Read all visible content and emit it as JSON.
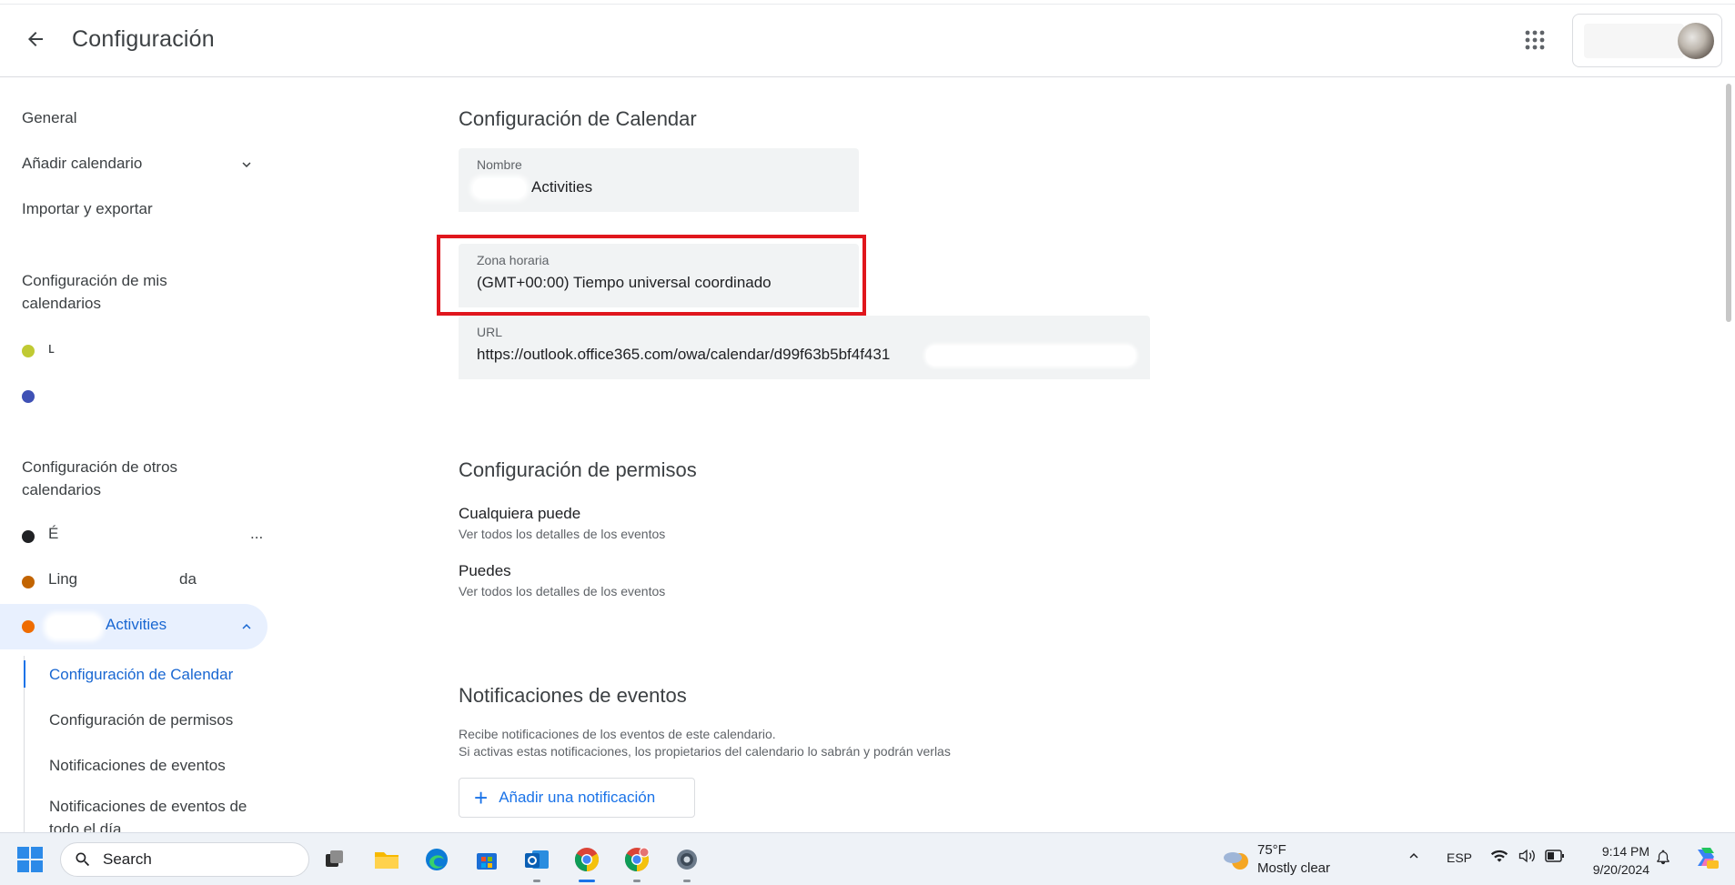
{
  "header": {
    "title": "Configuración"
  },
  "sidebar": {
    "general": "General",
    "add_calendar": "Añadir calendario",
    "import_export": "Importar y exportar",
    "my_calendars_title": "Configuración de mis calendarios",
    "my_calendars": [
      {
        "label": "ʟ",
        "color": "#c0ca33"
      },
      {
        "label": "",
        "color": "#3f51b5"
      }
    ],
    "other_calendars_title": "Configuración de otros calendarios",
    "other_calendars": [
      {
        "label": "É",
        "suffix": "...",
        "color": "#202124"
      },
      {
        "label": "Ling",
        "suffix": "da",
        "color": "#c26401"
      },
      {
        "label": "Activities",
        "color": "#ef6c00",
        "selected": true
      }
    ],
    "sub_items": [
      {
        "label": "Configuración de Calendar",
        "active": true
      },
      {
        "label": "Configuración de permisos"
      },
      {
        "label": "Notificaciones de eventos"
      },
      {
        "label": "Notificaciones de eventos de todo el día"
      }
    ]
  },
  "calendar_settings": {
    "title": "Configuración de Calendar",
    "name_label": "Nombre",
    "name_value": "Activities",
    "timezone_label": "Zona horaria",
    "timezone_value": "(GMT+00:00) Tiempo universal coordinado",
    "url_label": "URL",
    "url_value": "https://outlook.office365.com/owa/calendar/d99f63b5bf4f431",
    "highlight_color": "#e0161d"
  },
  "permissions": {
    "title": "Configuración de permisos",
    "items": [
      {
        "title": "Cualquiera puede",
        "desc": "Ver todos los detalles de los eventos"
      },
      {
        "title": "Puedes",
        "desc": "Ver todos los detalles de los eventos"
      }
    ]
  },
  "notifications": {
    "title": "Notificaciones de eventos",
    "desc_line1": "Recibe notificaciones de los eventos de este calendario.",
    "desc_line2": "Si activas estas notificaciones, los propietarios del calendario lo sabrán y podrán verlas",
    "add_button": "Añadir una notificación"
  },
  "taskbar": {
    "search_label": "Search",
    "weather_temp": "75°F",
    "weather_cond": "Mostly clear",
    "language": "ESP",
    "time": "9:14 PM",
    "date": "9/20/2024",
    "apps": [
      "task-view-icon",
      "file-explorer-icon",
      "edge-icon",
      "store-icon",
      "outlook-icon",
      "chrome-icon",
      "chrome-profile-icon",
      "settings-icon"
    ]
  }
}
